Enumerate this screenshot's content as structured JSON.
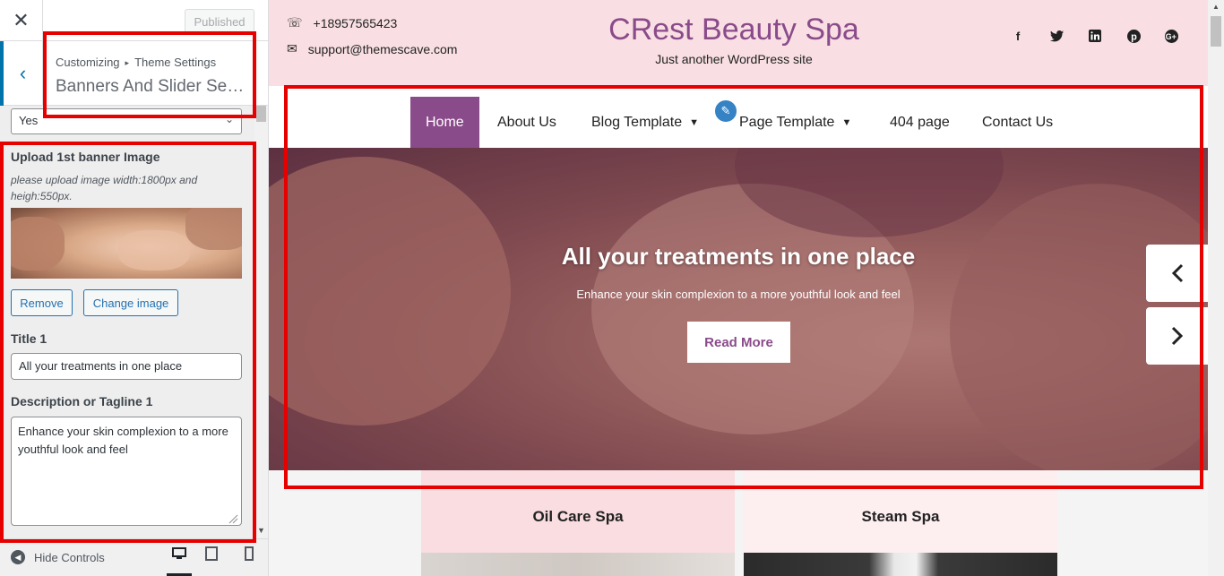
{
  "customizer": {
    "close_icon": "close-icon",
    "published_label": "Published",
    "breadcrumb": {
      "root": "Customizing",
      "current": "Theme Settings"
    },
    "section_title": "Banners And Slider Sett...",
    "enable_select_value": "Yes",
    "banner_image": {
      "label": "Upload 1st banner Image",
      "note": "please upload image width:1800px and heigh:550px.",
      "remove_label": "Remove",
      "change_label": "Change image"
    },
    "title_field": {
      "label": "Title 1",
      "value": "All your treatments in one place"
    },
    "description_field": {
      "label": "Description or Tagline 1",
      "value": "Enhance your skin complexion to a more youthful look and feel"
    },
    "footer": {
      "hide_controls_label": "Hide Controls",
      "active_device": "desktop"
    }
  },
  "site": {
    "phone": "+18957565423",
    "email": "support@themescave.com",
    "title": "CRest Beauty Spa",
    "tagline": "Just another WordPress site",
    "social_icons": [
      "facebook-icon",
      "twitter-icon",
      "linkedin-icon",
      "pinterest-icon",
      "google-plus-icon"
    ],
    "nav": {
      "home": "Home",
      "about": "About Us",
      "blog": "Blog Template",
      "page": "Page Template",
      "notfound": "404 page",
      "contact": "Contact Us"
    },
    "hero": {
      "title": "All your treatments in one place",
      "description": "Enhance your skin complexion to a more youthful look and feel",
      "button_label": "Read More"
    },
    "cards": [
      {
        "title": "Oil Care Spa"
      },
      {
        "title": "Steam Spa"
      }
    ]
  },
  "colors": {
    "accent": "#8a4b8a",
    "topbar_bg": "#f9dfe3",
    "highlight_box": "#e60000",
    "wp_blue": "#2271b1"
  }
}
